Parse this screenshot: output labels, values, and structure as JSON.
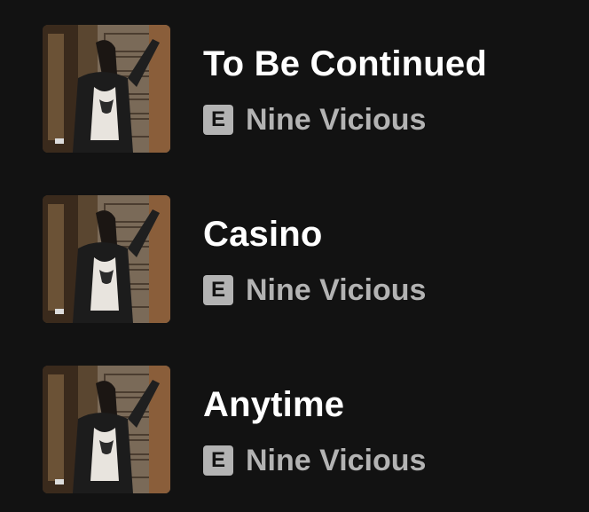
{
  "tracks": [
    {
      "title": "To Be Continued",
      "explicit_label": "E",
      "artist": "Nine Vicious"
    },
    {
      "title": "Casino",
      "explicit_label": "E",
      "artist": "Nine Vicious"
    },
    {
      "title": "Anytime",
      "explicit_label": "E",
      "artist": "Nine Vicious"
    }
  ],
  "colors": {
    "background": "#121212",
    "title": "#ffffff",
    "subtitle": "#b3b3b3",
    "badge_bg": "#b3b3b3"
  }
}
